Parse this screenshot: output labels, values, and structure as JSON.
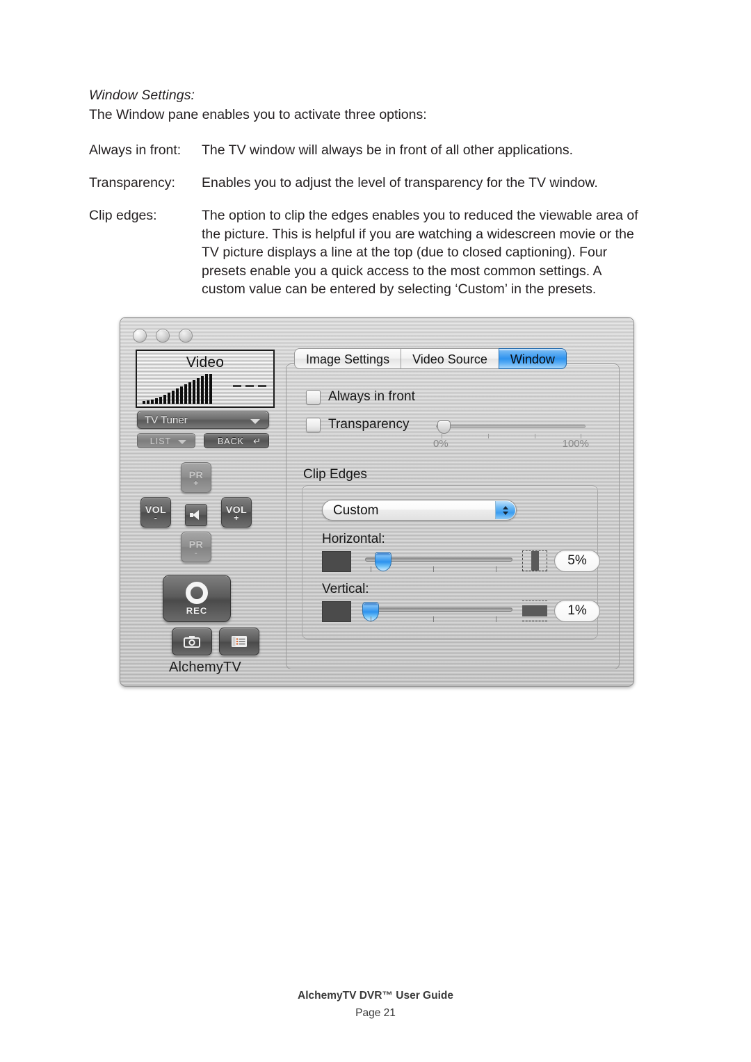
{
  "document": {
    "heading": "Window Settings:",
    "intro": "The Window pane enables you to activate three options:",
    "definitions": [
      {
        "term": "Always in front:",
        "body": "The TV window will always be in front of all other applications."
      },
      {
        "term": "Transparency:",
        "body": "Enables you to adjust the level of transparency for the TV window."
      },
      {
        "term": "Clip edges:",
        "body": "The option to clip the edges enables you to reduced the viewable area of the picture. This is helpful if you are watching a widescreen movie or the TV picture displays a line at the top (due to closed captioning). Four presets enable you a quick access to the most common settings. A custom value can be entered by selecting ‘Custom’ in the presets."
      }
    ]
  },
  "app": {
    "remote": {
      "screen_label": "Video",
      "source_button": "TV Tuner",
      "list_button": "LIST",
      "back_button": "BACK",
      "pr_up": "PR",
      "pr_up_sign": "+",
      "pr_down": "PR",
      "pr_down_sign": "-",
      "vol_down": "VOL",
      "vol_down_sign": "-",
      "vol_up": "VOL",
      "vol_up_sign": "+",
      "record_label": "REC",
      "brand": "AlchemyTV"
    },
    "tabs": [
      {
        "label": "Image Settings",
        "active": false
      },
      {
        "label": "Video Source",
        "active": false
      },
      {
        "label": "Window",
        "active": true
      }
    ],
    "window_pane": {
      "always_in_front": {
        "label": "Always in front",
        "checked": false
      },
      "transparency": {
        "label": "Transparency",
        "checked": false
      },
      "transparency_slider": {
        "min_label": "0%",
        "max_label": "100%",
        "value_percent": 0,
        "enabled": false
      },
      "clip_edges": {
        "group_label": "Clip Edges",
        "preset": "Custom",
        "horizontal": {
          "label": "Horizontal:",
          "value": "5%",
          "slider_percent": 10
        },
        "vertical": {
          "label": "Vertical:",
          "value": "1%",
          "slider_percent": 2
        }
      }
    }
  },
  "colors": {
    "accent_blue": "#2f93ef",
    "panel_gray": "#c9c9c9",
    "key_dark": "#5b5b5b",
    "swatch": "#4b4b4b"
  },
  "footer": {
    "title": "AlchemyTV DVR™ User Guide",
    "page": "Page 21"
  }
}
